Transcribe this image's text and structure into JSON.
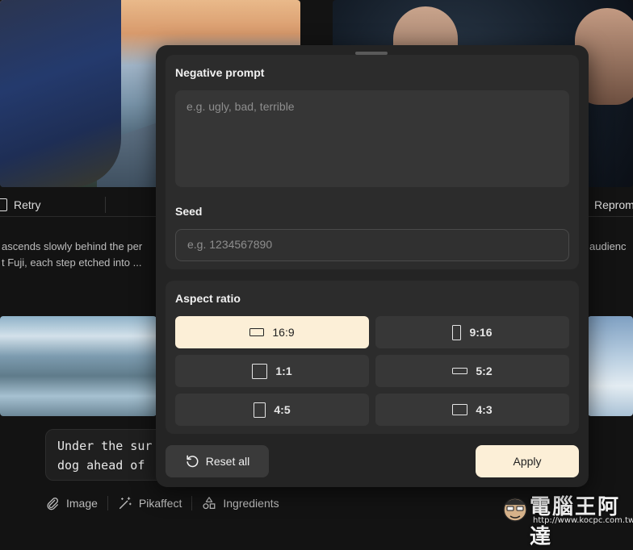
{
  "background": {
    "actions": {
      "retry_label": "Retry",
      "reprompt_label": "Repromp"
    },
    "captions": {
      "left_line1": "ascends slowly behind the per",
      "left_line2": "t Fuji, each step etched into ...",
      "right_line1": "audienc"
    },
    "prompt_text": "Under the sur\ndog ahead of",
    "tools": {
      "image_label": "Image",
      "pikaffect_label": "Pikaffect",
      "ingredients_label": "Ingredients"
    }
  },
  "modal": {
    "negative_prompt": {
      "label": "Negative prompt",
      "placeholder": "e.g. ugly, bad, terrible"
    },
    "seed": {
      "label": "Seed",
      "placeholder": "e.g. 1234567890"
    },
    "aspect_ratio": {
      "label": "Aspect ratio",
      "selected": "16:9",
      "options": [
        "16:9",
        "9:16",
        "1:1",
        "5:2",
        "4:5",
        "4:3"
      ]
    },
    "reset_label": "Reset all",
    "apply_label": "Apply"
  },
  "watermark": {
    "text": "電腦王阿達",
    "url": "http://www.kocpc.com.tw"
  },
  "colors": {
    "accent": "#fcefd7",
    "modal_bg": "#242424",
    "panel_bg": "#2c2c2c",
    "page_bg": "#131313"
  }
}
